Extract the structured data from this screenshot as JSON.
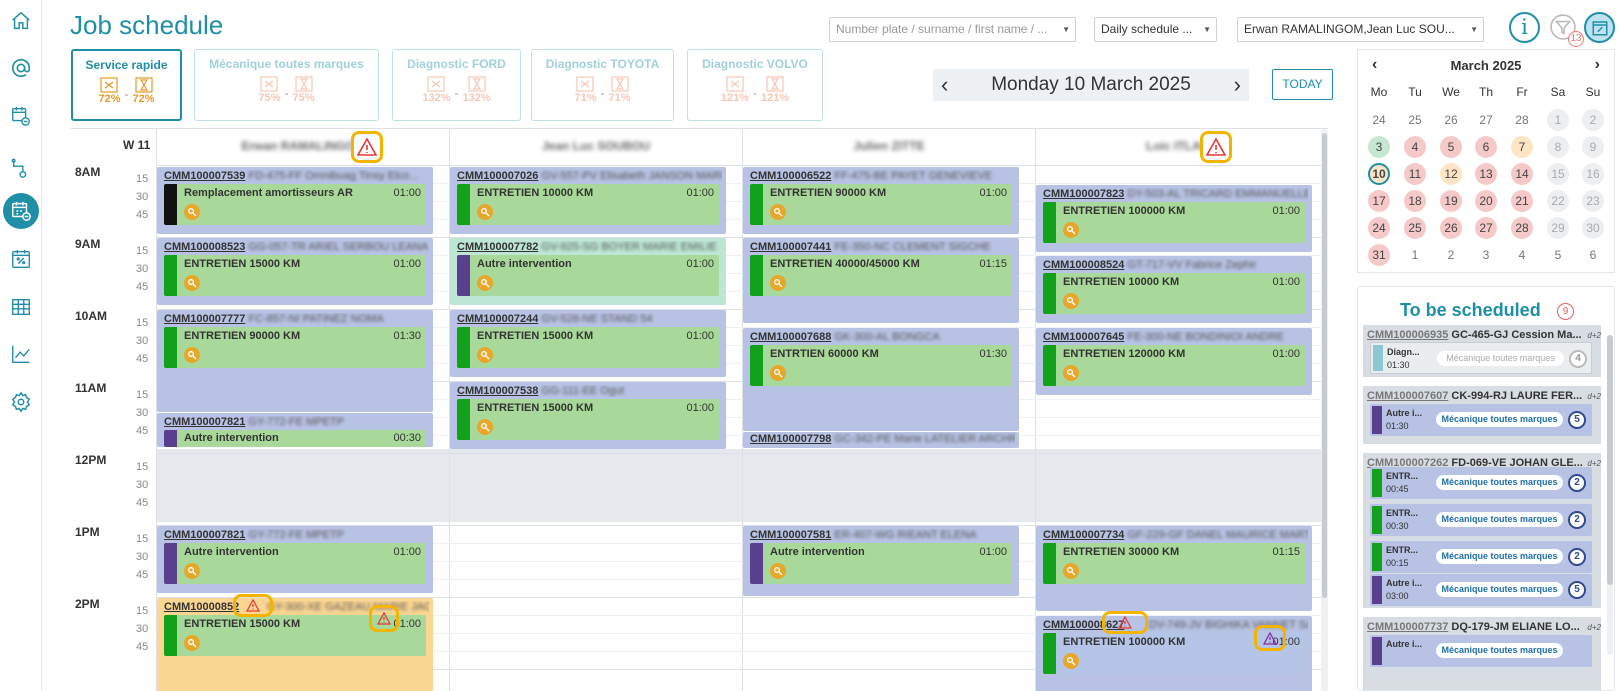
{
  "header": {
    "title": "Job schedule",
    "search_placeholder": "Number plate / surname / first name / ...",
    "view_select": "Daily schedule ...",
    "technicians_select": "Erwan RAMALINGOM,Jean Luc SOU...",
    "info_icon": "info-icon",
    "filter_count": "13"
  },
  "services": [
    {
      "name": "Service rapide",
      "pct1": "72%",
      "pct2": "72%",
      "active": true
    },
    {
      "name": "Mécanique toutes marques",
      "pct1": "75%",
      "pct2": "75%",
      "active": false
    },
    {
      "name": "Diagnostic FORD",
      "pct1": "132%",
      "pct2": "132%",
      "active": false
    },
    {
      "name": "Diagnostic TOYOTA",
      "pct1": "71%",
      "pct2": "71%",
      "active": false
    },
    {
      "name": "Diagnostic VOLVO",
      "pct1": "121%",
      "pct2": "121%",
      "active": false
    }
  ],
  "date_nav": {
    "prev": "‹",
    "label": "Monday 10 March 2025",
    "next": "›",
    "today": "TODAY"
  },
  "schedule": {
    "week": "W 11",
    "technicians": [
      "Erwan RAMALINGOM",
      "Jean Luc SOUBOU",
      "Julien ZITTE",
      "Loic ITLAND"
    ],
    "hours": [
      "8AM",
      "9AM",
      "10AM",
      "11AM",
      "12PM",
      "1PM",
      "2PM"
    ],
    "minutes": [
      "15",
      "30",
      "45"
    ],
    "appointments": [
      {
        "ref": "CMM100007539",
        "plate": "FD-475-FF Omnibuag Tinsy Elco...",
        "task": "Remplacement amortisseurs AR",
        "dur": "01:00"
      },
      {
        "ref": "CMM100008523",
        "plate": "GG-057-TR ARIEL SERBOU LEANA",
        "task": "ENTRETIEN 15000 KM",
        "dur": "01:00"
      },
      {
        "ref": "CMM100007777",
        "plate": "FC-857-NI PATINEZ NOMA",
        "task": "ENTRETIEN 90000 KM",
        "dur": "01:30"
      },
      {
        "ref": "CMM100007821",
        "plate": "GY-772-FE MPETP",
        "task": "Autre intervention",
        "dur": "00:30"
      },
      {
        "ref": "CMM100007821",
        "plate": "GY-772-FE MPETP",
        "task": "Autre intervention",
        "dur": "01:00"
      },
      {
        "ref": "CMM10000852",
        "plate": "GY-300-XE GAZEAU MARIE JACQ...",
        "task": "ENTRETIEN 15000 KM",
        "dur": "01:00"
      },
      {
        "ref": "CMM100007026",
        "plate": "GV-557-PV Elisabeth JANSON MARI...",
        "task": "ENTRETIEN 10000 KM",
        "dur": "01:00"
      },
      {
        "ref": "CMM100007782",
        "plate": "GV-925-SG BOYER MARIE EMILIE",
        "task": "Autre intervention",
        "dur": "01:00"
      },
      {
        "ref": "CMM100007244",
        "plate": "GV-528-NE STAND 54",
        "task": "ENTRETIEN 15000 KM",
        "dur": "01:00"
      },
      {
        "ref": "CMM100007538",
        "plate": "GG-111-EE Ogut",
        "task": "ENTRETIEN 15000 KM",
        "dur": "01:00"
      },
      {
        "ref": "CMM100006522",
        "plate": "FF-475-BE PAYET GENEVIEVE",
        "task": "ENTRETIEN 90000 KM",
        "dur": "01:00"
      },
      {
        "ref": "CMM100007441",
        "plate": "FE-350-NC CLEMENT SIGCHE",
        "task": "ENTRETIEN 40000/45000 KM",
        "dur": "01:15"
      },
      {
        "ref": "CMM100007688",
        "plate": "GK-300-AL BONGCA",
        "task": "ENTRTIEN 60000 KM",
        "dur": "01:30"
      },
      {
        "ref": "CMM100007798",
        "plate": "GC-342-PE Marie LATELIER ARCHR...",
        "task": "",
        "dur": ""
      },
      {
        "ref": "CMM100007581",
        "plate": "ER-407-WG RIEANT ELENA",
        "task": "Autre intervention",
        "dur": "01:00"
      },
      {
        "ref": "CMM100007823",
        "plate": "DY-503-AL TRICARD EMMANUELLE",
        "task": "ENTRETIEN 100000 KM",
        "dur": "01:00"
      },
      {
        "ref": "CMM100008524",
        "plate": "GT-717-VV Fabrice Zephir",
        "task": "ENTRETIEN 10000 KM",
        "dur": "01:00"
      },
      {
        "ref": "CMM100007645",
        "plate": "FE-300-NE BONDINIOI ANDRE",
        "task": "ENTRETIEN 120000 KM",
        "dur": "01:00"
      },
      {
        "ref": "CMM100007734",
        "plate": "GF-229-GF DANEL MAURICE MARTIN",
        "task": "ENTRETIEN 30000 KM",
        "dur": "01:15"
      },
      {
        "ref": "CMM100008627",
        "plate": "DV-749-JV BIGHIKA VANNET SAN...",
        "task": "ENTRETIEN 100000 KM",
        "dur": "01:00"
      }
    ]
  },
  "minical": {
    "month": "March 2025",
    "weekdays": [
      "Mo",
      "Tu",
      "We",
      "Th",
      "Fr",
      "Sa",
      "Su"
    ],
    "days": [
      "24",
      "25",
      "26",
      "27",
      "28",
      "1",
      "2",
      "3",
      "4",
      "5",
      "6",
      "7",
      "8",
      "9",
      "10",
      "11",
      "12",
      "13",
      "14",
      "15",
      "16",
      "17",
      "18",
      "19",
      "20",
      "21",
      "22",
      "23",
      "24",
      "25",
      "26",
      "27",
      "28",
      "29",
      "30",
      "31",
      "1",
      "2",
      "3",
      "4",
      "5",
      "6"
    ]
  },
  "to_schedule": {
    "title": "To be scheduled",
    "count": "9",
    "cards": [
      {
        "ref": "CMM100006935",
        "plate": "GC-465-GJ Cession Ma...",
        "tag": "d+2",
        "jobs": [
          {
            "title": "Diagn...",
            "dur": "01:30",
            "service": "Mécanique toutes marques",
            "n": "4"
          }
        ]
      },
      {
        "ref": "CMM100007607",
        "plate": "CK-994-RJ LAURE FER...",
        "tag": "d+2",
        "jobs": [
          {
            "title": "Autre i...",
            "dur": "01:30",
            "service": "Mécanique toutes marques",
            "n": "5"
          }
        ]
      },
      {
        "ref": "CMM100007262",
        "plate": "FD-069-VE JOHAN GLE...",
        "tag": "d+2",
        "jobs": [
          {
            "title": "ENTR...",
            "dur": "00:45",
            "service": "Mécanique toutes marques",
            "n": "2"
          },
          {
            "title": "ENTR...",
            "dur": "00:30",
            "service": "Mécanique toutes marques",
            "n": "2"
          },
          {
            "title": "ENTR...",
            "dur": "00:15",
            "service": "Mécanique toutes marques",
            "n": "2"
          },
          {
            "title": "Autre i...",
            "dur": "03:00",
            "service": "Mécanique toutes marques",
            "n": "5"
          }
        ]
      },
      {
        "ref": "CMM100007737",
        "plate": "DQ-179-JM ELIANE LO...",
        "tag": "d+2",
        "jobs": [
          {
            "title": "Autre i...",
            "dur": "",
            "service": "Mécanique toutes marques",
            "n": ""
          }
        ]
      }
    ]
  },
  "colors": {
    "accent": "#1f8fa8",
    "appointment": "#b8c2e4",
    "task": "#a9d99a",
    "warning": "#f3b400"
  }
}
